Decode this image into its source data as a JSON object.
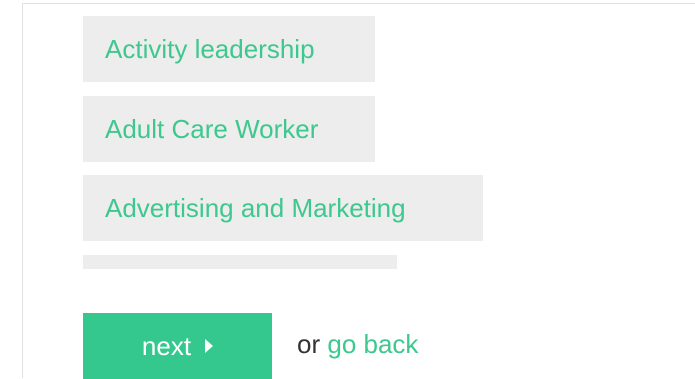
{
  "options": [
    {
      "label": "Activity leadership"
    },
    {
      "label": "Adult Care Worker"
    },
    {
      "label": "Advertising and Marketing"
    },
    {
      "label": ""
    }
  ],
  "actions": {
    "next_label": "next",
    "or_text": "or",
    "go_back_label": "go back"
  },
  "colors": {
    "accent": "#34c88e",
    "option_text": "#3ec78f",
    "option_bg": "#ededed"
  }
}
